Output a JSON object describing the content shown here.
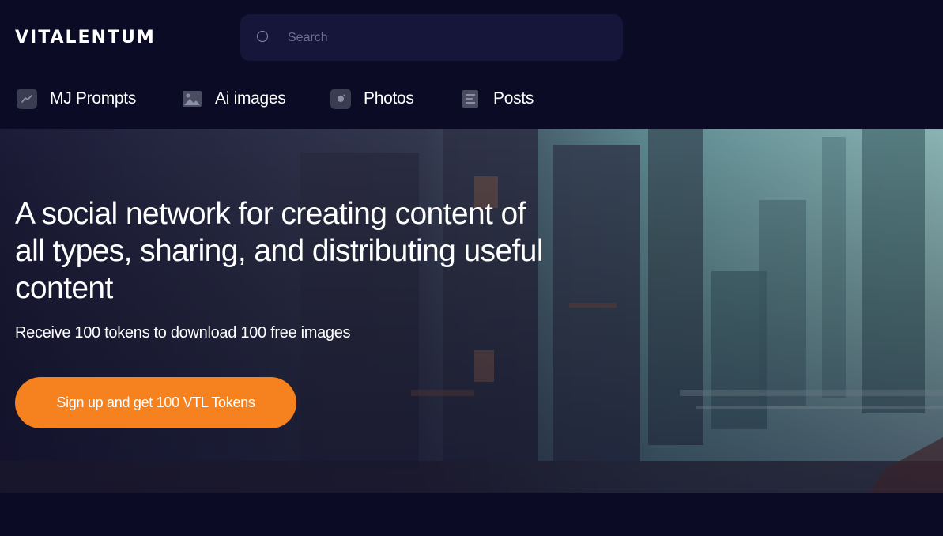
{
  "app": {
    "logo": "VITALENTUM"
  },
  "search": {
    "placeholder": "Search",
    "value": ""
  },
  "nav": {
    "items": [
      {
        "label": "MJ Prompts",
        "icon": "trend-chart-icon"
      },
      {
        "label": "Ai images",
        "icon": "image-icon"
      },
      {
        "label": "Photos",
        "icon": "camera-icon"
      },
      {
        "label": "Posts",
        "icon": "document-icon"
      }
    ]
  },
  "hero": {
    "title": "A social network for creating content of all types, sharing, and distributing useful content",
    "subtitle": "Receive 100 tokens to download 100 free images",
    "cta_label": "Sign up and get 100 VTL Tokens"
  },
  "colors": {
    "background": "#0c0b26",
    "search_bg": "#16163a",
    "accent": "#f5821f",
    "nav_icon_bg": "#3a3d52"
  }
}
